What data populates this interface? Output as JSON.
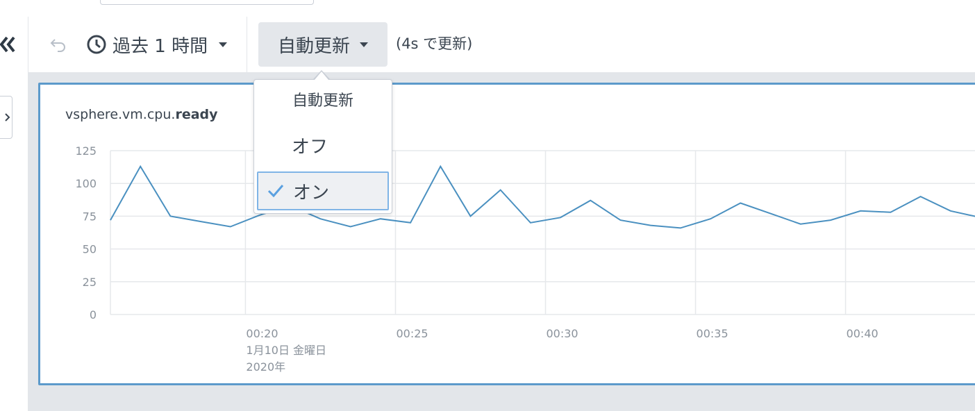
{
  "toolbar": {
    "time_range_label": "過去 1 時間",
    "autorefresh_label": "自動更新",
    "refresh_status": "(4s で更新)"
  },
  "autorefresh_menu": {
    "header": "自動更新",
    "items": [
      {
        "label": "オフ",
        "selected": false
      },
      {
        "label": "オン",
        "selected": true
      }
    ]
  },
  "panel": {
    "title_prefix": "vsphere.vm.cpu.",
    "title_bold": "ready"
  },
  "colors": {
    "accent": "#5c9acb",
    "line": "#4a90c0",
    "check": "#5aa0e0"
  },
  "chart_data": {
    "type": "line",
    "title": "vsphere.vm.cpu.ready",
    "ylim": [
      0,
      125
    ],
    "yticks": [
      0,
      25,
      50,
      75,
      100,
      125
    ],
    "xlim": [
      15.5,
      44.5
    ],
    "xticks": [
      {
        "value": 20,
        "lines": [
          "00:20",
          "1月10日 金曜日",
          "2020年"
        ]
      },
      {
        "value": 25,
        "lines": [
          "00:25"
        ]
      },
      {
        "value": 30,
        "lines": [
          "00:30"
        ]
      },
      {
        "value": 35,
        "lines": [
          "00:35"
        ]
      },
      {
        "value": 40,
        "lines": [
          "00:40"
        ]
      }
    ],
    "grid": true,
    "series": [
      {
        "x": [
          15.5,
          16.5,
          17.5,
          18.5,
          19.5,
          20.5,
          21.5,
          22.5,
          23.5,
          24.5,
          25.5,
          26.5,
          27.5,
          28.5,
          29.5,
          30.5,
          31.5,
          32.5,
          33.5,
          34.5,
          35.5,
          36.5,
          37.5,
          38.5,
          39.5,
          40.5,
          41.5,
          42.5,
          43.5,
          44.5
        ],
        "y": [
          72,
          113,
          75,
          71,
          67,
          76,
          83,
          73,
          67,
          73,
          70,
          113,
          75,
          95,
          70,
          74,
          87,
          72,
          68,
          66,
          73,
          85,
          77,
          69,
          72,
          79,
          78,
          90,
          79,
          74
        ]
      }
    ]
  }
}
